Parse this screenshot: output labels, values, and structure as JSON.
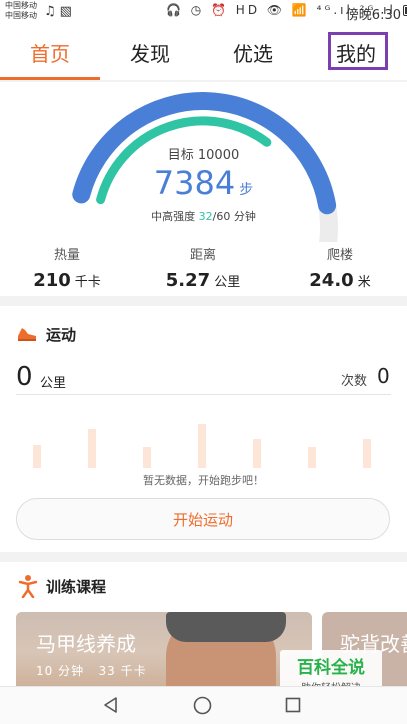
{
  "status_bar": {
    "carrier_1": "中国移动",
    "carrier_2": "中国移动",
    "left_icons": [
      "music-note-icon",
      "activity-icon"
    ],
    "right_icons_text": "🎧 ◷ ⏰ HD 👁 📶 ⁴ᴳ.ıl ²ᴳ.ıl",
    "time": "傍晚6:30"
  },
  "tabs": [
    {
      "label": "首页",
      "active": true
    },
    {
      "label": "发现",
      "active": false
    },
    {
      "label": "优选",
      "active": false
    },
    {
      "label": "我的",
      "active": false,
      "highlighted": true
    }
  ],
  "gauge": {
    "target_text": "目标 10000",
    "steps": "7384",
    "steps_unit": "步",
    "steps_progress": 0.7384,
    "intensity_prefix": "中高强度 ",
    "intensity_value": "32",
    "intensity_suffix": "/60 分钟",
    "intensity_progress": 0.5333,
    "colors": {
      "steps": "#4a7fd8",
      "intensity": "#2ec4a4",
      "track": "#ececec"
    }
  },
  "metrics": [
    {
      "label": "热量",
      "value": "210",
      "unit": "千卡"
    },
    {
      "label": "距离",
      "value": "5.27",
      "unit": "公里"
    },
    {
      "label": "爬楼",
      "value": "24.0",
      "unit": "米"
    }
  ],
  "exercise": {
    "title": "运动",
    "distance_value": "0",
    "distance_unit": "公里",
    "count_label": "次数",
    "count_value": "0",
    "no_data_text": "暂无数据，开始跑步吧！",
    "start_button": "开始运动",
    "placeholder_bar_levels": [
      0.45,
      0.75,
      0.4,
      0.85,
      0.55,
      0.4,
      0.55
    ]
  },
  "courses": {
    "title": "训练课程",
    "items": [
      {
        "name": "马甲线养成",
        "duration": "10 分钟",
        "calories": "33 千卡"
      },
      {
        "name": "驼背改善"
      }
    ]
  },
  "watermark": {
    "title": "百科全说",
    "subtitle": "助你轻松解决"
  },
  "nav": {
    "icons": [
      "back-icon",
      "home-icon",
      "recent-apps-icon"
    ]
  },
  "accent_color": "#ef6d2c"
}
